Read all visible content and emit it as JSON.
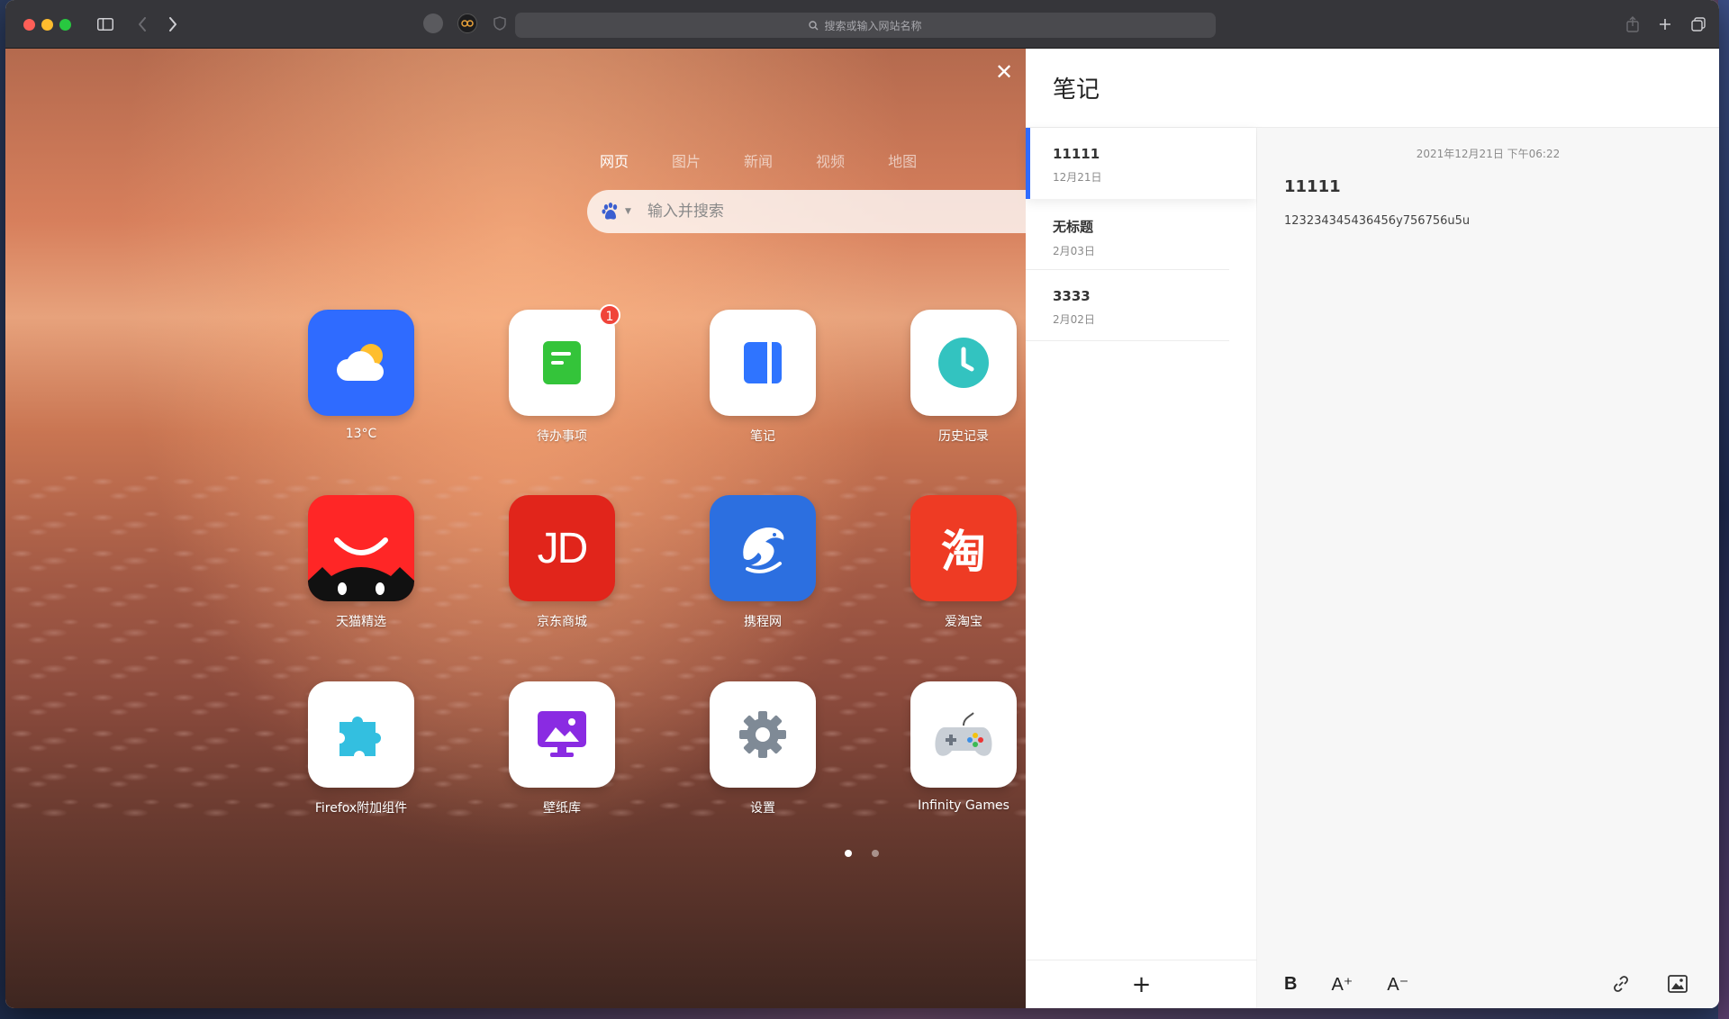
{
  "browser": {
    "address_placeholder": "搜索或输入网站名称"
  },
  "newtab": {
    "close_label": "✕",
    "search_tabs": [
      "网页",
      "图片",
      "新闻",
      "视频",
      "地图"
    ],
    "search_placeholder": "输入并搜索",
    "apps": [
      {
        "label": "13°C",
        "icon": "weather-icon",
        "color": "#2f6bff"
      },
      {
        "label": "待办事项",
        "icon": "todo-icon",
        "badge": "1",
        "color": "#34c43a"
      },
      {
        "label": "笔记",
        "icon": "notes-icon",
        "color": "#2f74ff"
      },
      {
        "label": "历史记录",
        "icon": "history-clock-icon",
        "color": "#33c3c0"
      },
      {
        "label": "天猫精选",
        "icon": "tmall-icon",
        "color": "#ff2626"
      },
      {
        "label": "京东商城",
        "icon": "jd-icon",
        "text": "JD",
        "color": "#e1251b"
      },
      {
        "label": "携程网",
        "icon": "ctrip-dolphin-icon",
        "color": "#2c6fe0"
      },
      {
        "label": "爱淘宝",
        "icon": "taobao-icon",
        "text": "淘",
        "color": "#ee3b24"
      },
      {
        "label": "Firefox附加组件",
        "icon": "puzzle-icon",
        "color": "#33bfe0"
      },
      {
        "label": "壁纸库",
        "icon": "wallpaper-icon",
        "color": "#8a2be2"
      },
      {
        "label": "设置",
        "icon": "gear-icon",
        "color": "#7f8a96"
      },
      {
        "label": "Infinity Games",
        "icon": "gamepad-icon",
        "color": "#c9cfd6"
      }
    ],
    "page_dots": 2,
    "active_dot": 0
  },
  "notes": {
    "header_title": "笔记",
    "items": [
      {
        "title": "11111",
        "date": "12月21日"
      },
      {
        "title": "无标题",
        "date": "2月03日"
      },
      {
        "title": "3333",
        "date": "2月02日"
      }
    ],
    "add_label": "+",
    "editor": {
      "timestamp": "2021年12月21日 下午06:22",
      "title": "11111",
      "body": "123234345436456y756756u5u"
    },
    "tools": {
      "bold": "B",
      "increase": "A⁺",
      "decrease": "A⁻"
    }
  }
}
